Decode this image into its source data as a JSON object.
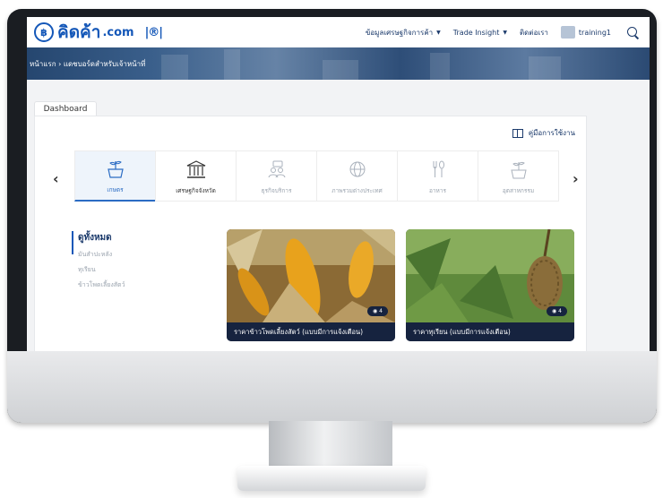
{
  "site": {
    "logo_text": "คิดค้า",
    "logo_suffix": ".com",
    "partner_mark": "|®|"
  },
  "nav": {
    "items": [
      {
        "label": "ข้อมูลเศรษฐกิจการค้า",
        "has_dropdown": true
      },
      {
        "label": "Trade Insight",
        "has_dropdown": true
      },
      {
        "label": "ติดต่อเรา",
        "has_dropdown": false
      }
    ],
    "user_name": "training1"
  },
  "breadcrumb": "หน้าแรก › แดชบอร์ดสำหรับเจ้าหน้าที่",
  "tabs": [
    {
      "label": "Dashboard",
      "active": true
    }
  ],
  "manual_link": "คู่มือการใช้งาน",
  "categories": [
    {
      "label": "เกษตร",
      "icon": "plant-pot-icon",
      "active": true
    },
    {
      "label": "เศรษฐกิจจังหวัด",
      "icon": "bank-building-icon",
      "active": false
    },
    {
      "label": "ธุรกิจบริการ",
      "icon": "service-people-icon",
      "active": false
    },
    {
      "label": "ภาพรวมต่างประเทศ",
      "icon": "globe-icon",
      "active": false
    },
    {
      "label": "อาหาร",
      "icon": "fork-spoon-icon",
      "active": false
    },
    {
      "label": "อุตสาหกรรม",
      "icon": "plant-pot-icon",
      "active": false
    }
  ],
  "filters": {
    "title": "ดูทั้งหมด",
    "items": [
      "มันสำปะหลัง",
      "ทุเรียน",
      "ข้าวโพดเลี้ยงสัตว์"
    ]
  },
  "cards": [
    {
      "title": "ราคาข้าวโพดเลี้ยงสัตว์ (แบบมีการแจ้งเตือน)",
      "views": "4",
      "photo": "corn"
    },
    {
      "title": "ราคาทุเรียน (แบบมีการแจ้งเตือน)",
      "views": "4",
      "photo": "durian"
    }
  ],
  "colors": {
    "brand": "#1457b8",
    "navy": "#16233f",
    "active_tab": "#eef4fb"
  }
}
